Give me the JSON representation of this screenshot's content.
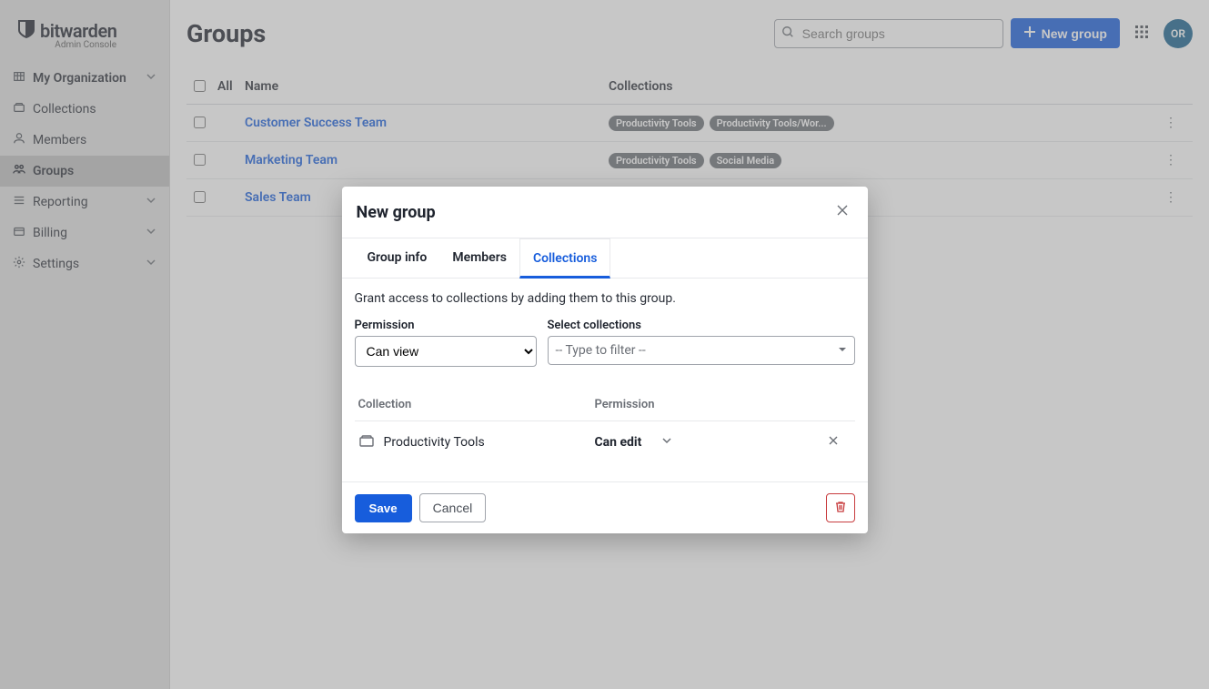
{
  "brand": {
    "name": "bitwarden",
    "subtitle": "Admin Console"
  },
  "sidebar": {
    "items": [
      {
        "label": "My Organization",
        "icon": "org-icon",
        "chevron": true
      },
      {
        "label": "Collections",
        "icon": "collections-icon",
        "chevron": false
      },
      {
        "label": "Members",
        "icon": "members-icon",
        "chevron": false
      },
      {
        "label": "Groups",
        "icon": "groups-icon",
        "chevron": false,
        "active": true
      },
      {
        "label": "Reporting",
        "icon": "reporting-icon",
        "chevron": true
      },
      {
        "label": "Billing",
        "icon": "billing-icon",
        "chevron": true
      },
      {
        "label": "Settings",
        "icon": "settings-icon",
        "chevron": true
      }
    ]
  },
  "header": {
    "title": "Groups",
    "search_placeholder": "Search groups",
    "new_button": "New group",
    "avatar_initials": "OR"
  },
  "table": {
    "col_all": "All",
    "col_name": "Name",
    "col_collections": "Collections",
    "rows": [
      {
        "name": "Customer Success Team",
        "badges": [
          "Productivity Tools",
          "Productivity Tools/Wor..."
        ]
      },
      {
        "name": "Marketing Team",
        "badges": [
          "Productivity Tools",
          "Social Media"
        ]
      },
      {
        "name": "Sales Team",
        "badges": []
      }
    ]
  },
  "modal": {
    "title": "New group",
    "tabs": [
      "Group info",
      "Members",
      "Collections"
    ],
    "active_tab": 2,
    "description": "Grant access to collections by adding them to this group.",
    "permission_label": "Permission",
    "permission_value": "Can view",
    "select_label": "Select collections",
    "select_placeholder": "-- Type to filter --",
    "mini": {
      "col_collection": "Collection",
      "col_permission": "Permission",
      "rows": [
        {
          "name": "Productivity Tools",
          "permission": "Can edit"
        }
      ]
    },
    "save_label": "Save",
    "cancel_label": "Cancel"
  }
}
